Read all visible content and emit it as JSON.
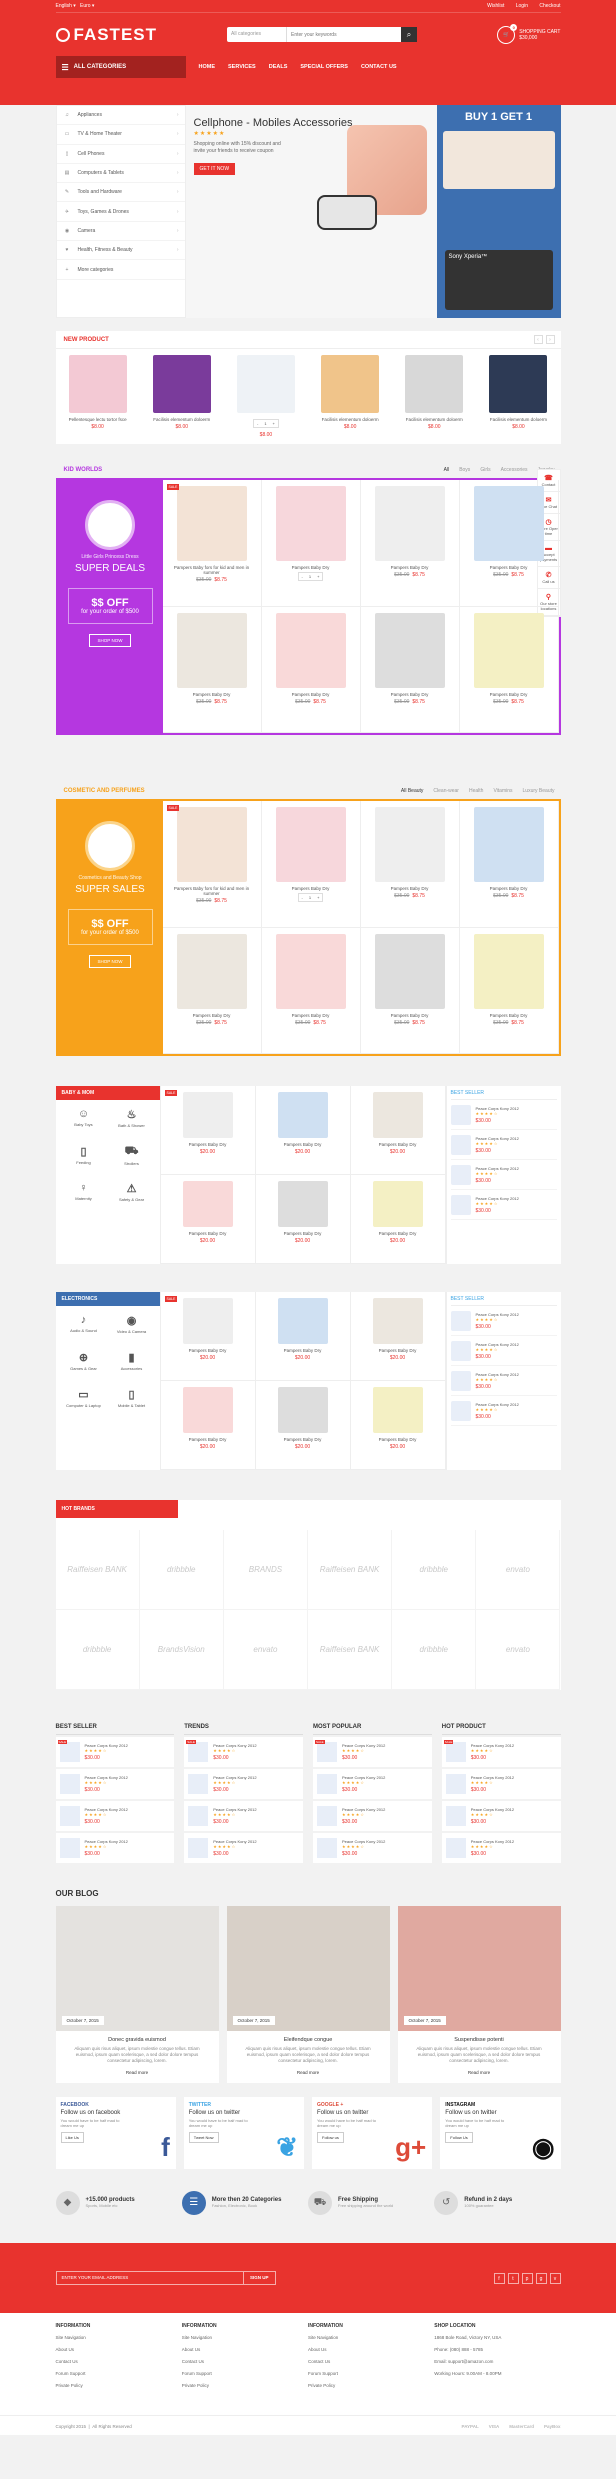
{
  "topbar": {
    "lang": "English",
    "currency": "Euro",
    "links": [
      "Wishlist",
      "Login",
      "Checkout"
    ]
  },
  "header": {
    "logo": "FASTEST",
    "search_category": "All categories",
    "search_placeholder": "Enter your keywords",
    "cart_label": "SHOPPING CART",
    "cart_total": "$30,000",
    "cart_count": "0"
  },
  "nav": {
    "all_categories": "ALL CATEGORIES",
    "menu": [
      "HOME",
      "SERVICES",
      "DEALS",
      "SPECIAL OFFERS",
      "CONTACT US"
    ]
  },
  "sidebar": {
    "items": [
      "Appliances",
      "TV & Home Theater",
      "Cell Phones",
      "Computers & Tablets",
      "Tools and Hardware",
      "Toys, Games & Drones",
      "Camera",
      "Health, Fitness & Beauty",
      "More categories"
    ]
  },
  "banner": {
    "title": "Cellphone - Mobiles Accessories",
    "text": "Shopping online with 15% discount and invite your friends to receive coupon",
    "button": "GET IT NOW"
  },
  "promo": {
    "title": "BUY 1 GET 1",
    "phone": "Sony Xperia™"
  },
  "new_product": {
    "title": "NEW PRODUCT",
    "items": [
      {
        "name": "Pellentesque lectu tortor fsce",
        "price": "$8.00"
      },
      {
        "name": "Facilisis elementum doloerm",
        "price": "$8.00"
      },
      {
        "name": "Facilisis elementum doloerm",
        "price": "$8.00"
      },
      {
        "name": "Facilisis elementum doloerm",
        "price": "$8.00"
      },
      {
        "name": "Facilisis elementum doloerm",
        "price": "$8.00"
      },
      {
        "name": "Facilisis elementum doloerm",
        "price": "$8.00"
      }
    ]
  },
  "float": [
    "Contact",
    "Live Chat",
    "Store Open time",
    "Accept payments",
    "Call us",
    "Our store locations"
  ],
  "kid": {
    "title": "KID WORLDS",
    "tabs": [
      "All",
      "Boys",
      "Girls",
      "Accessories",
      "Jewelry"
    ],
    "deal_small": "Little Girls Princess Dress",
    "deal_big": "SUPER DEALS",
    "off": "$$ OFF",
    "off_sub": "for your order of $500",
    "shop": "SHOP NOW",
    "items": [
      {
        "name": "Pampers Baby fors for kid and men in summer",
        "old": "$35.00",
        "price": "$8.75"
      },
      {
        "name": "Pampers Baby Dry",
        "old": "",
        "price": ""
      },
      {
        "name": "Pampers Baby Dry",
        "old": "$35.00",
        "price": "$8.75"
      },
      {
        "name": "Pampers Baby Dry",
        "old": "$35.00",
        "price": "$8.75"
      },
      {
        "name": "Pampers Baby Dry",
        "old": "$35.00",
        "price": "$8.75"
      },
      {
        "name": "Pampers Baby Dry",
        "old": "$35.00",
        "price": "$8.75"
      },
      {
        "name": "Pampers Baby Dry",
        "old": "$35.00",
        "price": "$8.75"
      },
      {
        "name": "Pampers Baby Dry",
        "old": "$35.00",
        "price": "$8.75"
      }
    ]
  },
  "cosmetic": {
    "title": "COSMETIC AND PERFUMES",
    "tabs": [
      "All Beauty",
      "Clean-wear",
      "Health",
      "Vitamins",
      "Luxury Beauty"
    ],
    "deal_small": "Cosmetics and Beauty Shop",
    "deal_big": "SUPER SALES",
    "off": "$$ OFF",
    "off_sub": "for your order of $500",
    "shop": "SHOP NOW",
    "items": [
      {
        "name": "Pampers Baby fors for kid and men in summer",
        "old": "$35.00",
        "price": "$8.75"
      },
      {
        "name": "Pampers Baby Dry",
        "old": "",
        "price": ""
      },
      {
        "name": "Pampers Baby Dry",
        "old": "$35.00",
        "price": "$8.75"
      },
      {
        "name": "Pampers Baby Dry",
        "old": "$35.00",
        "price": "$8.75"
      },
      {
        "name": "Pampers Baby Dry",
        "old": "$35.00",
        "price": "$8.75"
      },
      {
        "name": "Pampers Baby Dry",
        "old": "$35.00",
        "price": "$8.75"
      },
      {
        "name": "Pampers Baby Dry",
        "old": "$35.00",
        "price": "$8.75"
      },
      {
        "name": "Pampers Baby Dry",
        "old": "$35.00",
        "price": "$8.75"
      }
    ]
  },
  "baby": {
    "title": "BABY & MOM",
    "cats": [
      "Baby Toys",
      "Bath & Shower",
      "Feeding",
      "Strollers",
      "Maternity",
      "Safety & Gear"
    ],
    "items": [
      "Pampers Baby Dry",
      "Pampers Baby Dry",
      "Pampers Baby Dry",
      "Pampers Baby Dry",
      "Pampers Baby Dry",
      "Pampers Baby Dry"
    ],
    "price": "$20.00",
    "best_title": "BEST SELLER",
    "best": [
      "Peace Corps Kony 2012",
      "Peace Corps Kony 2012",
      "Peace Corps Kony 2012",
      "Peace Corps Kony 2012"
    ],
    "best_price": "$30.00"
  },
  "electronics": {
    "title": "ELECTRONICS",
    "cats": [
      "Audio & Sound",
      "Video & Camera",
      "Games & Gear",
      "Accessories",
      "Computer & Laptop",
      "Mobile & Tablet"
    ],
    "items": [
      "Pampers Baby Dry",
      "Pampers Baby Dry",
      "Pampers Baby Dry",
      "Pampers Baby Dry",
      "Pampers Baby Dry",
      "Pampers Baby Dry"
    ],
    "price": "$20.00",
    "best_title": "BEST SELLER",
    "best": [
      "Peace Corps Kony 2012",
      "Peace Corps Kony 2012",
      "Peace Corps Kony 2012",
      "Peace Corps Kony 2012"
    ],
    "best_price": "$30.00"
  },
  "brands": {
    "title": "HOT BRANDS",
    "logos": [
      "Raiffeisen BANK",
      "dribbble",
      "BRANDS",
      "Raiffeisen BANK",
      "dribbble",
      "envato",
      "dribbble",
      "BrandsVision",
      "envato",
      "Raiffeisen BANK",
      "dribbble",
      "envato"
    ]
  },
  "lists": [
    {
      "title": "BEST SELLER",
      "items": [
        "Peace Corps Kony 2012",
        "Peace Corps Kony 2012",
        "Peace Corps Kony 2012",
        "Peace Corps Kony 2012"
      ]
    },
    {
      "title": "TRENDS",
      "items": [
        "Peace Corps Kony 2012",
        "Peace Corps Kony 2012",
        "Peace Corps Kony 2012",
        "Peace Corps Kony 2012"
      ]
    },
    {
      "title": "MOST POPULAR",
      "items": [
        "Peace Corps Kony 2012",
        "Peace Corps Kony 2012",
        "Peace Corps Kony 2012",
        "Peace Corps Kony 2012"
      ]
    },
    {
      "title": "HOT PRODUCT",
      "items": [
        "Peace Corps Kony 2012",
        "Peace Corps Kony 2012",
        "Peace Corps Kony 2012",
        "Peace Corps Kony 2012"
      ]
    }
  ],
  "list_price": "$30.00",
  "blog": {
    "title": "OUR BLOG",
    "posts": [
      {
        "date": "October 7, 2015",
        "title": "Donec gravida euismod",
        "text": "Aliquam quis risus aliquet, ipsum molestie congue tellus. Etiam euismod, ipsum quam scelerisque, a sed dolor dolore tempus consectetur adipiscing, lorem.",
        "more": "Read more"
      },
      {
        "date": "October 7, 2015",
        "title": "Eleifendque congue",
        "text": "Aliquam quis risus aliquet, ipsum molestie congue tellus. Etiam euismod, ipsum quam scelerisque, a sed dolor dolore tempus consectetur adipiscing, lorem.",
        "more": "Read more"
      },
      {
        "date": "October 7, 2015",
        "title": "Suspendisse potenti",
        "text": "Aliquam quis risus aliquet, ipsum molestie congue tellus. Etiam euismod, ipsum quam scelerisque, a sed dolor dolore tempus consectetur adipiscing, lorem.",
        "more": "Read more"
      }
    ]
  },
  "social": [
    {
      "net": "FACEBOOK",
      "title": "Follow us on facebook",
      "text": "You would have to be half mad to dream me up",
      "button": "Like Us",
      "glyph": "f",
      "color": "#3b5998"
    },
    {
      "net": "TWITTER",
      "title": "Follow us on twitter",
      "text": "You would have to be half mad to dream me up",
      "button": "Tweet Now",
      "glyph": "❦",
      "color": "#3aa3e3"
    },
    {
      "net": "GOOGLE +",
      "title": "Follow us on twitter",
      "text": "You would have to be half mad to dream me up",
      "button": "Follow us",
      "glyph": "g+",
      "color": "#dd4b39"
    },
    {
      "net": "INSTAGRAM",
      "title": "Follow us on twitter",
      "text": "You would have to be half mad to dream me up",
      "button": "Follow Us",
      "glyph": "◉",
      "color": "#111111"
    }
  ],
  "features": [
    {
      "title": "+15.000 products",
      "sub": "Sports, Mobile etc"
    },
    {
      "title": "More then 20 Categories",
      "sub": "Fashion, Electronic, Book"
    },
    {
      "title": "Free Shipping",
      "sub": "Free shipping around the world"
    },
    {
      "title": "Refund in 2 days",
      "sub": "100% guarantee"
    }
  ],
  "newsletter": {
    "placeholder": "ENTER YOUR EMAIL ADDRESS",
    "button": "SIGN UP",
    "socials": [
      "f",
      "t",
      "p",
      "g",
      "v"
    ]
  },
  "footer": {
    "cols": [
      {
        "title": "INFORMATION",
        "items": [
          "Site Navigation",
          "About Us",
          "Contact Us",
          "Forum Support",
          "Private Policy"
        ]
      },
      {
        "title": "INFORMATION",
        "items": [
          "Site Navigation",
          "About Us",
          "Contact Us",
          "Forum Support",
          "Private Policy"
        ]
      },
      {
        "title": "INFORMATION",
        "items": [
          "Site Navigation",
          "About Us",
          "Contact Us",
          "Forum Support",
          "Private Policy"
        ]
      },
      {
        "title": "SHOP LOCATION",
        "items": [
          "1868 Bole Road, Victory NY, USA",
          "Phone: (080) 888 - 5785",
          "Email: support@amazon.com",
          "Working Hours: 9.00AM - 8.00PM"
        ]
      }
    ],
    "copyright": "Copyright 2015",
    "rights": "All Rights Reserved",
    "pays": [
      "PAYPAL",
      "VISA",
      "MasterCard",
      "PayBox"
    ]
  },
  "colors": {
    "brand": "#e8332e",
    "kid": "#b537e0",
    "cosmetic": "#f7a21b",
    "baby": "#e8332e",
    "electronics": "#3d6fb0"
  }
}
